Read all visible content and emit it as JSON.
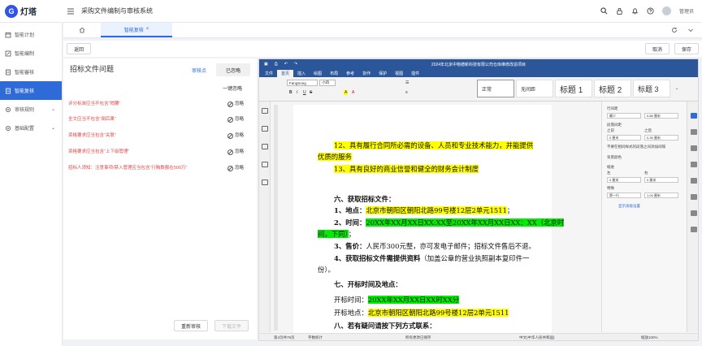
{
  "app": {
    "logo_text": "灯塔",
    "title": "采购文件编制与审核系统",
    "user": "管理员"
  },
  "sidebar": {
    "items": [
      {
        "label": "智能计划",
        "active": false
      },
      {
        "label": "智能编制",
        "active": false
      },
      {
        "label": "智能審核",
        "active": false
      },
      {
        "label": "智能复核",
        "active": true
      },
      {
        "label": "审核规则",
        "active": false,
        "expandable": true
      },
      {
        "label": "基础配置",
        "active": false,
        "expandable": true
      }
    ]
  },
  "tabs": [
    {
      "label": "智能复核",
      "close": "×"
    }
  ],
  "actions": {
    "back": "返回",
    "cancel": "取消",
    "save": "保存"
  },
  "issues": {
    "title": "招标文件问题",
    "tab_review": "审核点",
    "tab_ignored": "已忽略",
    "ignore_all": "一键忽略",
    "ignore_label": "忽略",
    "items": [
      "评分标准应当不包含“稍腰”",
      "全文应当不包含“阐后果”",
      "资格要求应当包含“关联”",
      "资格要求应当包含“上下级管理”",
      "招标人须知：注意事项/禁入管理应当包含“行贿数额在500万”"
    ],
    "reaudit": "重新审核",
    "download": "下载文件"
  },
  "editor": {
    "doc_title": "2024年北京中物德新科技有限公司仓库维修改造项目",
    "menus": [
      "文件",
      "首页",
      "插入",
      "绘图",
      "布局",
      "参考",
      "协作",
      "保护",
      "视图",
      "插件"
    ],
    "active_menu": "首页",
    "font_name": "FangSong",
    "font_size": "小四",
    "styles": [
      "正常",
      "无间距",
      "标题 1",
      "标题 2",
      "标题 3"
    ],
    "selected_style": "正常",
    "paragraphs": {
      "p12a": "12、具有履行合同所必需的设备、人员和专业技术能力，并能提供",
      "p12b": "优质的服务",
      "p13": "13、具有良好的商业信誉和健全的财务会计制度",
      "h6": "六、获取招标文件：",
      "addr_lbl": "1、地点：",
      "addr_val": "北京市朝阳区朝阳北路99号楼12层2单元1511",
      "addr_end": "；",
      "time_lbl": "2、时间：",
      "time_val1": "20XX年XX月XX日XX:XX至20XX年XX月XX日XX：XX（北京时",
      "time_val2": "间，下同）",
      "time_end": "；",
      "price_lbl": "3、售价：",
      "price_val": "人民币300元整，亦可发电子邮件；招标文件售后不退。",
      "doc_lbl": "4、获取招标文件需提供资料",
      "doc_val1": "（加盖公章的营业执照副本复印件一",
      "doc_val2": "份）。",
      "h7": "七、开标时间及地点：",
      "open_time_lbl": "开标时间：",
      "open_time_val": "20XX年XX月XX日XX时XX分",
      "open_place_lbl": "开标地点：",
      "open_place_val": "北京市朝阳区朝阳北路99号楼12层2单元1511",
      "h8": "八、若有疑问请按下列方式联系："
    },
    "panel": {
      "line_spacing": "行间距",
      "line_spacing_val": "最少",
      "line_spacing_num": "0.88 厘米",
      "para_spacing": "段落间距",
      "before": "之前",
      "after": "之后",
      "before_val": "0 厘米",
      "after_val": "0.35 厘米",
      "no_space_same": "不要在相同样式的段落之间添加间隔",
      "bg_color": "背景颜色",
      "indent": "缩进",
      "left": "左",
      "right": "右",
      "left_val": "0 厘米",
      "right_val": "0 厘米",
      "special": "特殊",
      "special_val": "第一行",
      "special_num": "1.04 厘米",
      "show_settings": "显示高级设置"
    },
    "status": {
      "page": "第4页共79页",
      "word_count": "字数统计",
      "saved": "所有更改已保存",
      "lang": "中文(中华人民共和国)",
      "zoom": "缩放100%"
    }
  }
}
